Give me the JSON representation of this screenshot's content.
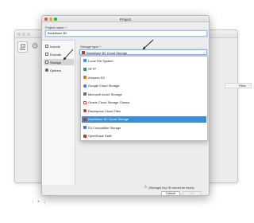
{
  "background_window": {
    "new_label": "New",
    "column_header": "Files",
    "bottom_icons": [
      "↑",
      "+",
      "↓"
    ]
  },
  "dialog": {
    "title": "Project",
    "project_name_label": "Project name: *",
    "project_name_value": "Backblaze B2",
    "sidebar": {
      "items": [
        {
          "label": "Include",
          "icon": "include-icon"
        },
        {
          "label": "Exclude",
          "icon": "exclude-icon"
        },
        {
          "label": "Storage",
          "icon": "storage-icon",
          "selected": true
        },
        {
          "label": "Options",
          "icon": "gear-icon"
        }
      ]
    },
    "storage_type_label": "Storage type: *",
    "storage_type_selected": "Backblaze B2 Cloud Storage",
    "storage_options": [
      {
        "label": "Local File System",
        "color": "#4a90d9"
      },
      {
        "label": "SFTP",
        "color": "#2e9e4a"
      },
      {
        "label": "Amazon S3",
        "color": "#e07b1a"
      },
      {
        "label": "Google Cloud Storage",
        "color": "#3b7de1"
      },
      {
        "label": "Microsoft Azure Storage",
        "color": "#5a6f86"
      },
      {
        "label": "Oracle Cloud Storage Classic",
        "color": "#d9442f"
      },
      {
        "label": "Rackspace Cloud Files",
        "color": "#c0392b"
      },
      {
        "label": "Backblaze B2 Cloud Storage",
        "color": "#c0392b",
        "highlighted": true
      },
      {
        "label": "S3 Compatible Storage",
        "color": "#3b7de1"
      },
      {
        "label": "OpenStack Swift",
        "color": "#c0392b"
      }
    ],
    "warning_text": "[Storage] Key ID cannot be empty",
    "cancel_label": "Cancel",
    "ok_label": "OK"
  },
  "colors": {
    "highlight": "#3b8ed8",
    "warning": "#d94b3a",
    "focus_ring": "#8fb2e3"
  }
}
